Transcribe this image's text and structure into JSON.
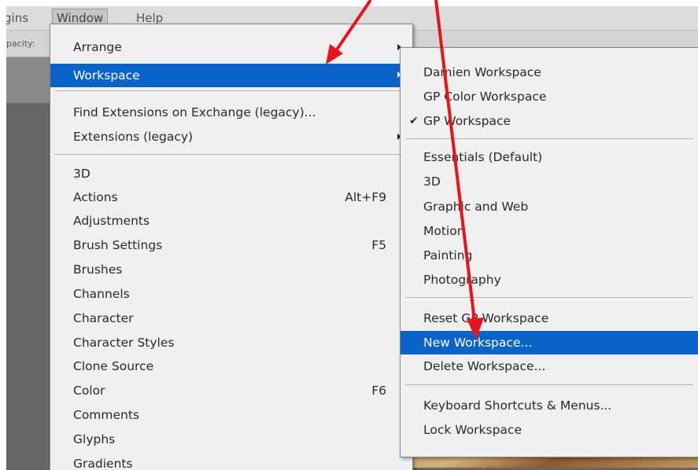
{
  "menubar": {
    "items": [
      "gins",
      "Window",
      "Help"
    ]
  },
  "options_bar": {
    "opacity_label": "pacity:"
  },
  "window_menu": {
    "items": [
      {
        "label": "Arrange",
        "submenu": true
      },
      {
        "label": "Workspace",
        "submenu": true,
        "highlighted": true
      },
      {
        "label": "Find Extensions on Exchange (legacy)..."
      },
      {
        "label": "Extensions (legacy)",
        "submenu": true
      },
      {
        "label": "3D"
      },
      {
        "label": "Actions",
        "shortcut": "Alt+F9"
      },
      {
        "label": "Adjustments"
      },
      {
        "label": "Brush Settings",
        "shortcut": "F5"
      },
      {
        "label": "Brushes"
      },
      {
        "label": "Channels"
      },
      {
        "label": "Character"
      },
      {
        "label": "Character Styles"
      },
      {
        "label": "Clone Source"
      },
      {
        "label": "Color",
        "shortcut": "F6"
      },
      {
        "label": "Comments"
      },
      {
        "label": "Glyphs"
      },
      {
        "label": "Gradients"
      }
    ]
  },
  "workspace_menu": {
    "items": [
      {
        "label": "Damien Workspace"
      },
      {
        "label": "GP Color Workspace"
      },
      {
        "label": "GP Workspace",
        "checked": true,
        "check": "✔"
      },
      {
        "label": "Essentials (Default)"
      },
      {
        "label": "3D"
      },
      {
        "label": "Graphic and Web"
      },
      {
        "label": "Motion"
      },
      {
        "label": "Painting"
      },
      {
        "label": "Photography"
      },
      {
        "label": "Reset GP Workspace"
      },
      {
        "label": "New Workspace...",
        "highlighted": true
      },
      {
        "label": "Delete Workspace..."
      },
      {
        "label": "Keyboard Shortcuts & Menus..."
      },
      {
        "label": "Lock Workspace"
      }
    ]
  },
  "colors": {
    "highlight": "#0a64c8",
    "annotation_arrow": "#e8141c",
    "menu_background": "#f0f0f0"
  }
}
